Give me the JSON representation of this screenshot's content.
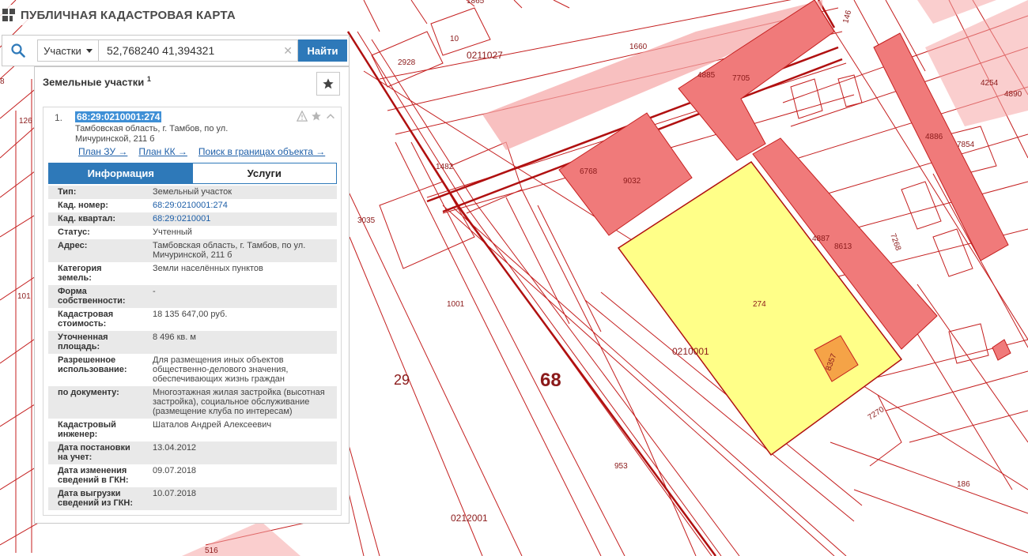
{
  "app": {
    "title": "ПУБЛИЧНАЯ КАДАСТРОВАЯ КАРТА"
  },
  "search": {
    "type_label": "Участки",
    "query": "52,768240 41,394321",
    "submit_label": "Найти"
  },
  "panel": {
    "title": "Земельные участки",
    "count": "1",
    "result": {
      "index": "1.",
      "number": "68:29:0210001:274",
      "address": "Тамбовская область, г. Тамбов, по ул. Мичуринской, 211 б",
      "links": [
        "План ЗУ →",
        "План КК →",
        "Поиск в границах объекта →"
      ]
    },
    "tabs": [
      "Информация",
      "Услуги"
    ],
    "info": [
      {
        "k": "Тип:",
        "v": "Земельный участок"
      },
      {
        "k": "Кад. номер:",
        "v": "68:29:0210001:274"
      },
      {
        "k": "Кад. квартал:",
        "v": "68:29:0210001"
      },
      {
        "k": "Статус:",
        "v": "Учтенный"
      },
      {
        "k": "Адрес:",
        "v": "Тамбовская область, г. Тамбов, по ул. Мичуринской, 211 б"
      },
      {
        "k": "Категория земель:",
        "v": "Земли населённых пунктов"
      },
      {
        "k": "Форма собственности:",
        "v": "-"
      },
      {
        "k": "Кадастровая стоимость:",
        "v": "18 135 647,00 руб."
      },
      {
        "k": "Уточненная площадь:",
        "v": "8 496 кв. м"
      },
      {
        "k": "Разрешенное использование:",
        "v": "Для размещения иных объектов общественно-делового значения, обеспечивающих жизнь граждан"
      },
      {
        "k": "по документу:",
        "v": "Многоэтажная жилая застройка (высотная застройка), социальное обслуживание (размещение клуба по интересам)"
      },
      {
        "k": "Кадастровый инженер:",
        "v": "Шаталов Андрей Алексеевич"
      },
      {
        "k": "Дата постановки на учет:",
        "v": "13.04.2012"
      },
      {
        "k": "Дата изменения сведений в ГКН:",
        "v": "09.07.2018"
      },
      {
        "k": "Дата выгрузки сведений из ГКН:",
        "v": "10.07.2018"
      }
    ]
  },
  "map": {
    "colors": {
      "boundary": "#c41e1e",
      "building": "#f07a7a",
      "selected_parcel": "#ffff88",
      "small_object": "#f5a347"
    },
    "labels": {
      "l1660": "1660",
      "l10": "10",
      "l2928": "2928",
      "l0211027": "0211027",
      "l4885": "4885",
      "l7705": "7705",
      "l146": "146",
      "l4254": "4254",
      "l4890": "4890",
      "l4886": "4886",
      "l7854": "7854",
      "l126": "126",
      "l1482": "1482",
      "l6768": "6768",
      "l9032": "9032",
      "l3035": "3035",
      "l7268": "7268",
      "l4887": "4887",
      "l8613": "8613",
      "l274": "274",
      "l101": "101",
      "l1001": "1001",
      "l0210001": "0210001",
      "l29": "29",
      "l68": "68",
      "l8357": "8357",
      "l7270": "7270",
      "l953": "953",
      "l186": "186",
      "l0212001": "0212001",
      "l516": "516",
      "l1865": "1865",
      "l8": "8"
    }
  }
}
